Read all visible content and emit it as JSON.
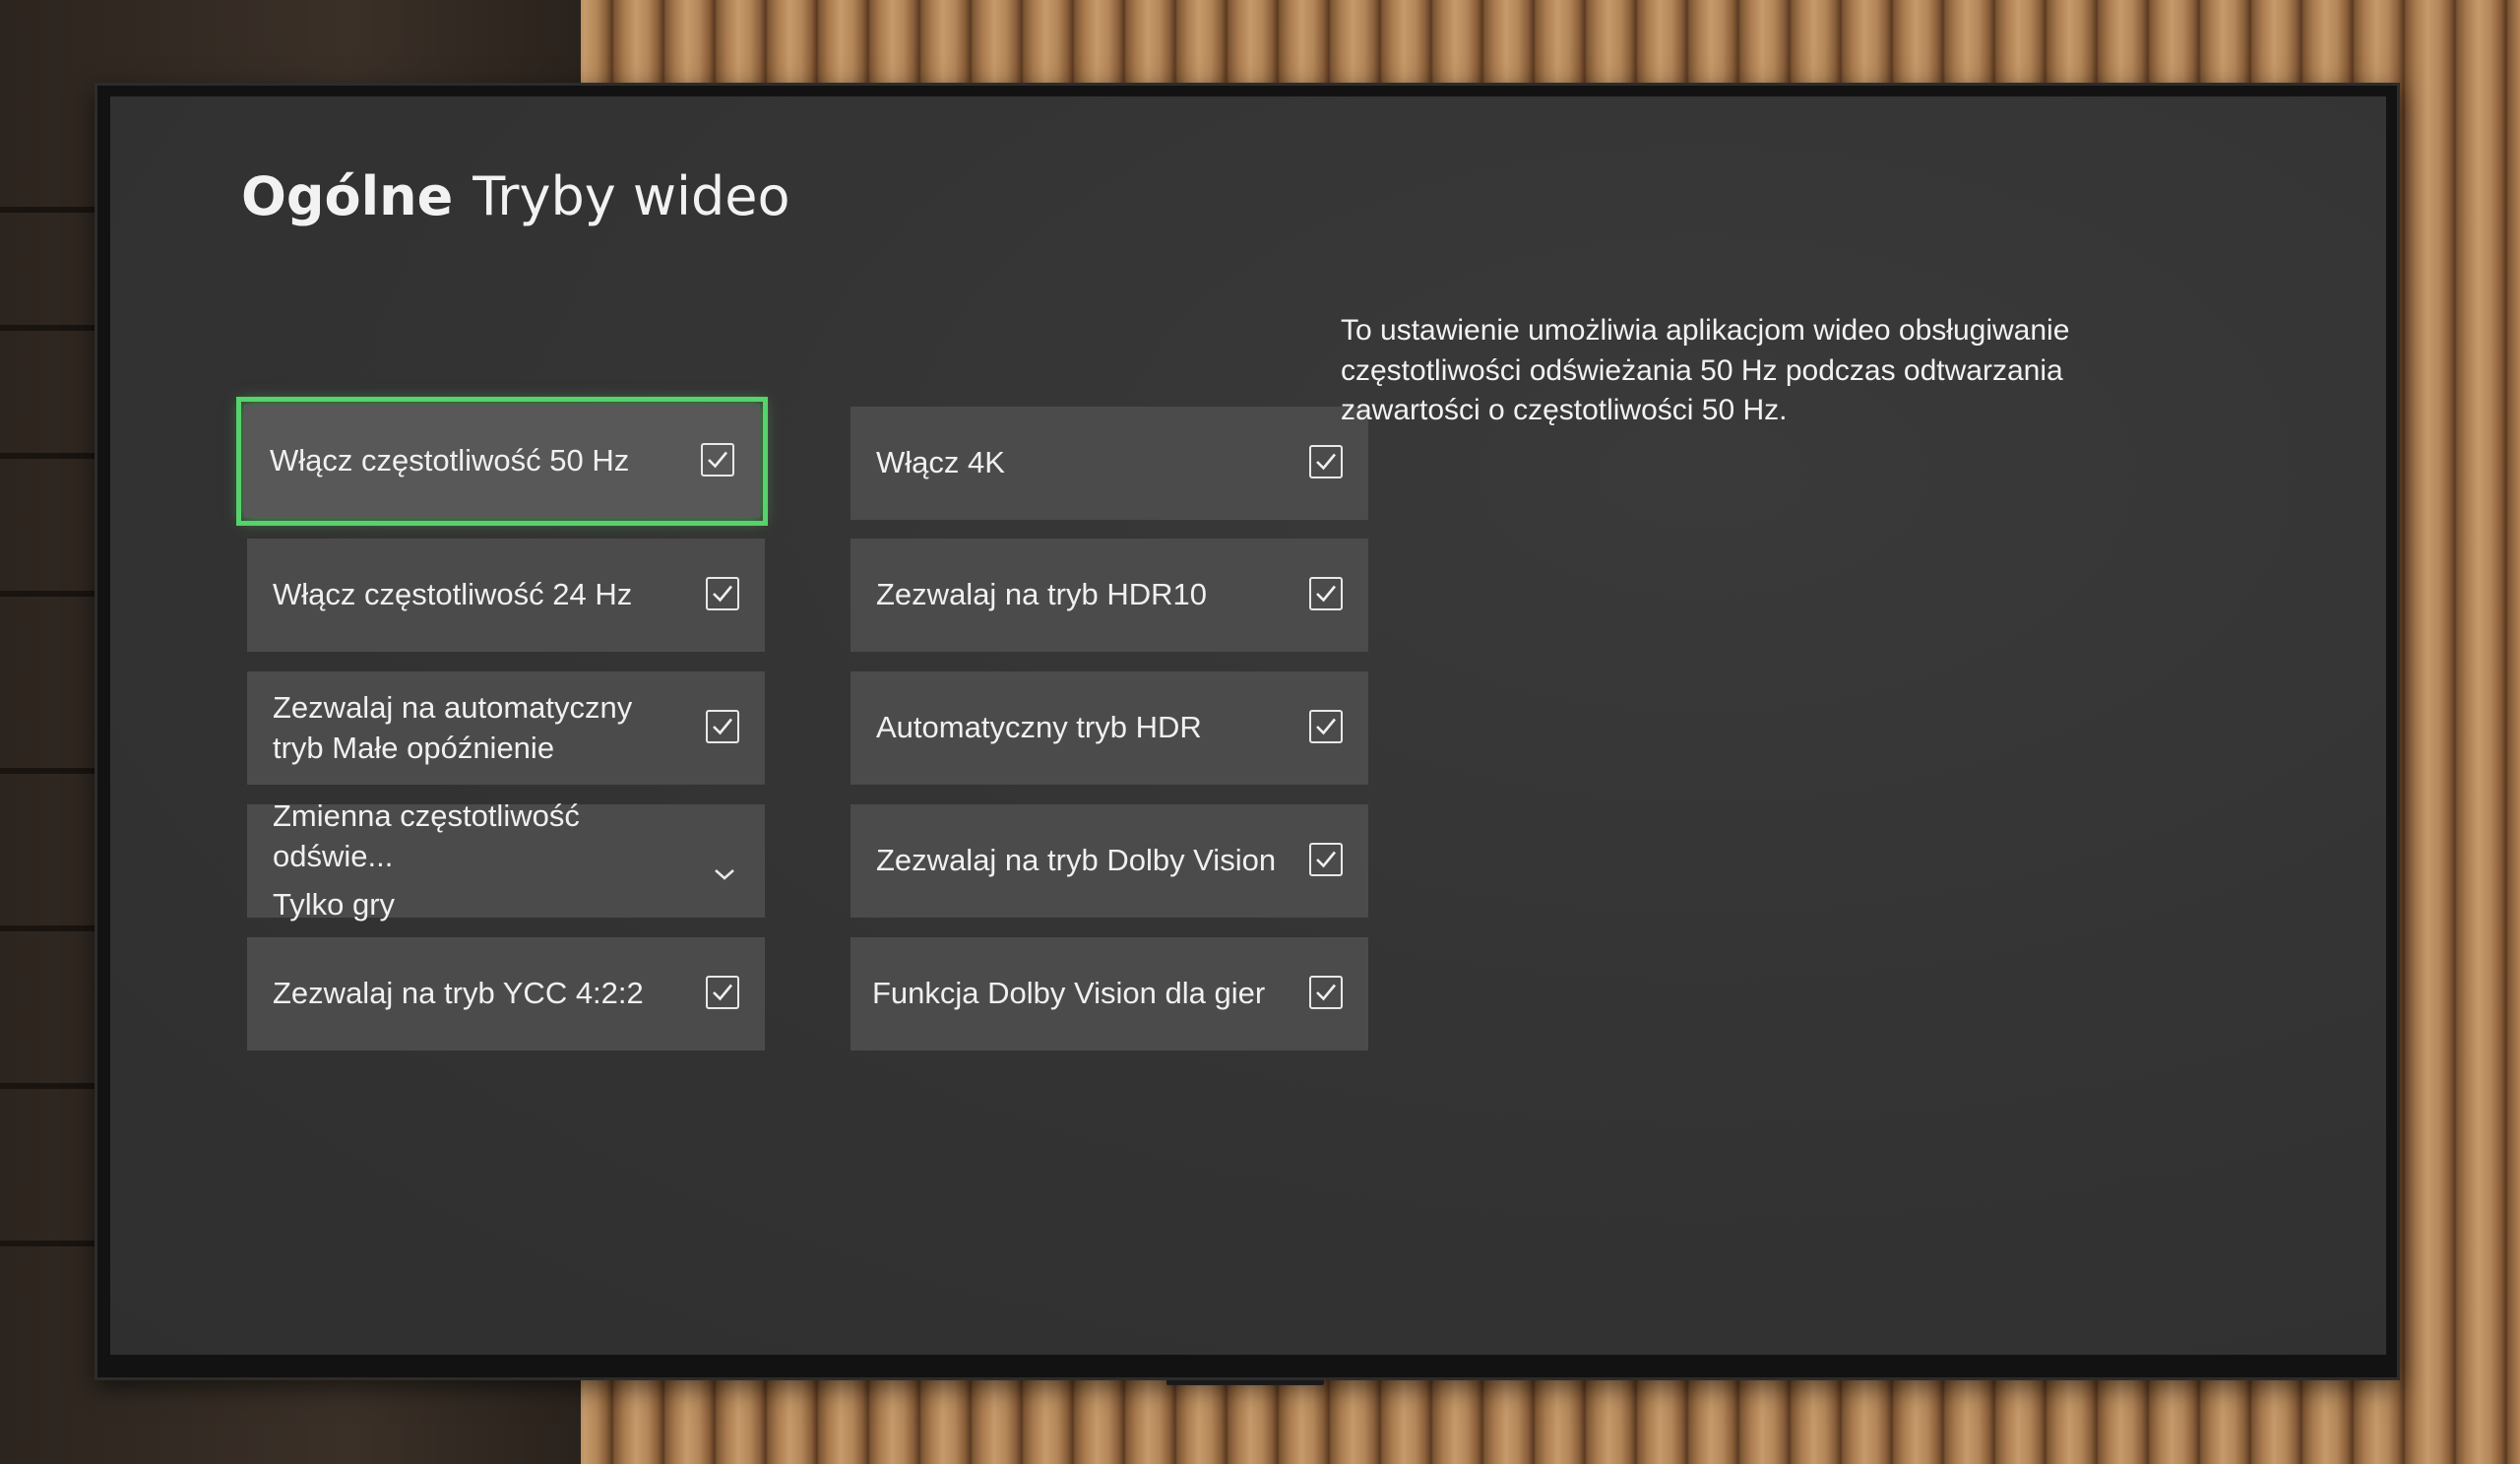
{
  "header": {
    "breadcrumb": "Ogólne",
    "title": "Tryby wideo"
  },
  "settings": {
    "left": [
      {
        "label": "Włącz częstotliwość 50 Hz",
        "checked": true,
        "focused": true
      },
      {
        "label": "Włącz częstotliwość 24 Hz",
        "checked": true
      },
      {
        "label": "Zezwalaj na automatyczny tryb Małe opóźnienie",
        "checked": true
      },
      {
        "label": "Zmienna częstotliwość odświe...",
        "type": "dropdown",
        "value": "Tylko gry"
      },
      {
        "label": "Zezwalaj na tryb YCC 4:2:2",
        "checked": true
      }
    ],
    "right": [
      {
        "label": "Włącz 4K",
        "checked": true
      },
      {
        "label": "Zezwalaj na tryb HDR10",
        "checked": true
      },
      {
        "label": "Automatyczny tryb HDR",
        "checked": true
      },
      {
        "label": "Zezwalaj na tryb Dolby Vision",
        "checked": true
      },
      {
        "label": "Funkcja Dolby Vision dla gier",
        "checked": true
      }
    ]
  },
  "description": "To ustawienie umożliwia aplikacjom wideo obsługiwanie częstotliwości odświeżania 50 Hz podczas odtwarzania zawartości o częstotliwości 50 Hz.",
  "colors": {
    "focus_accent": "#56d36a",
    "tile_background": "#4b4b4b",
    "screen_background": "#343434"
  }
}
